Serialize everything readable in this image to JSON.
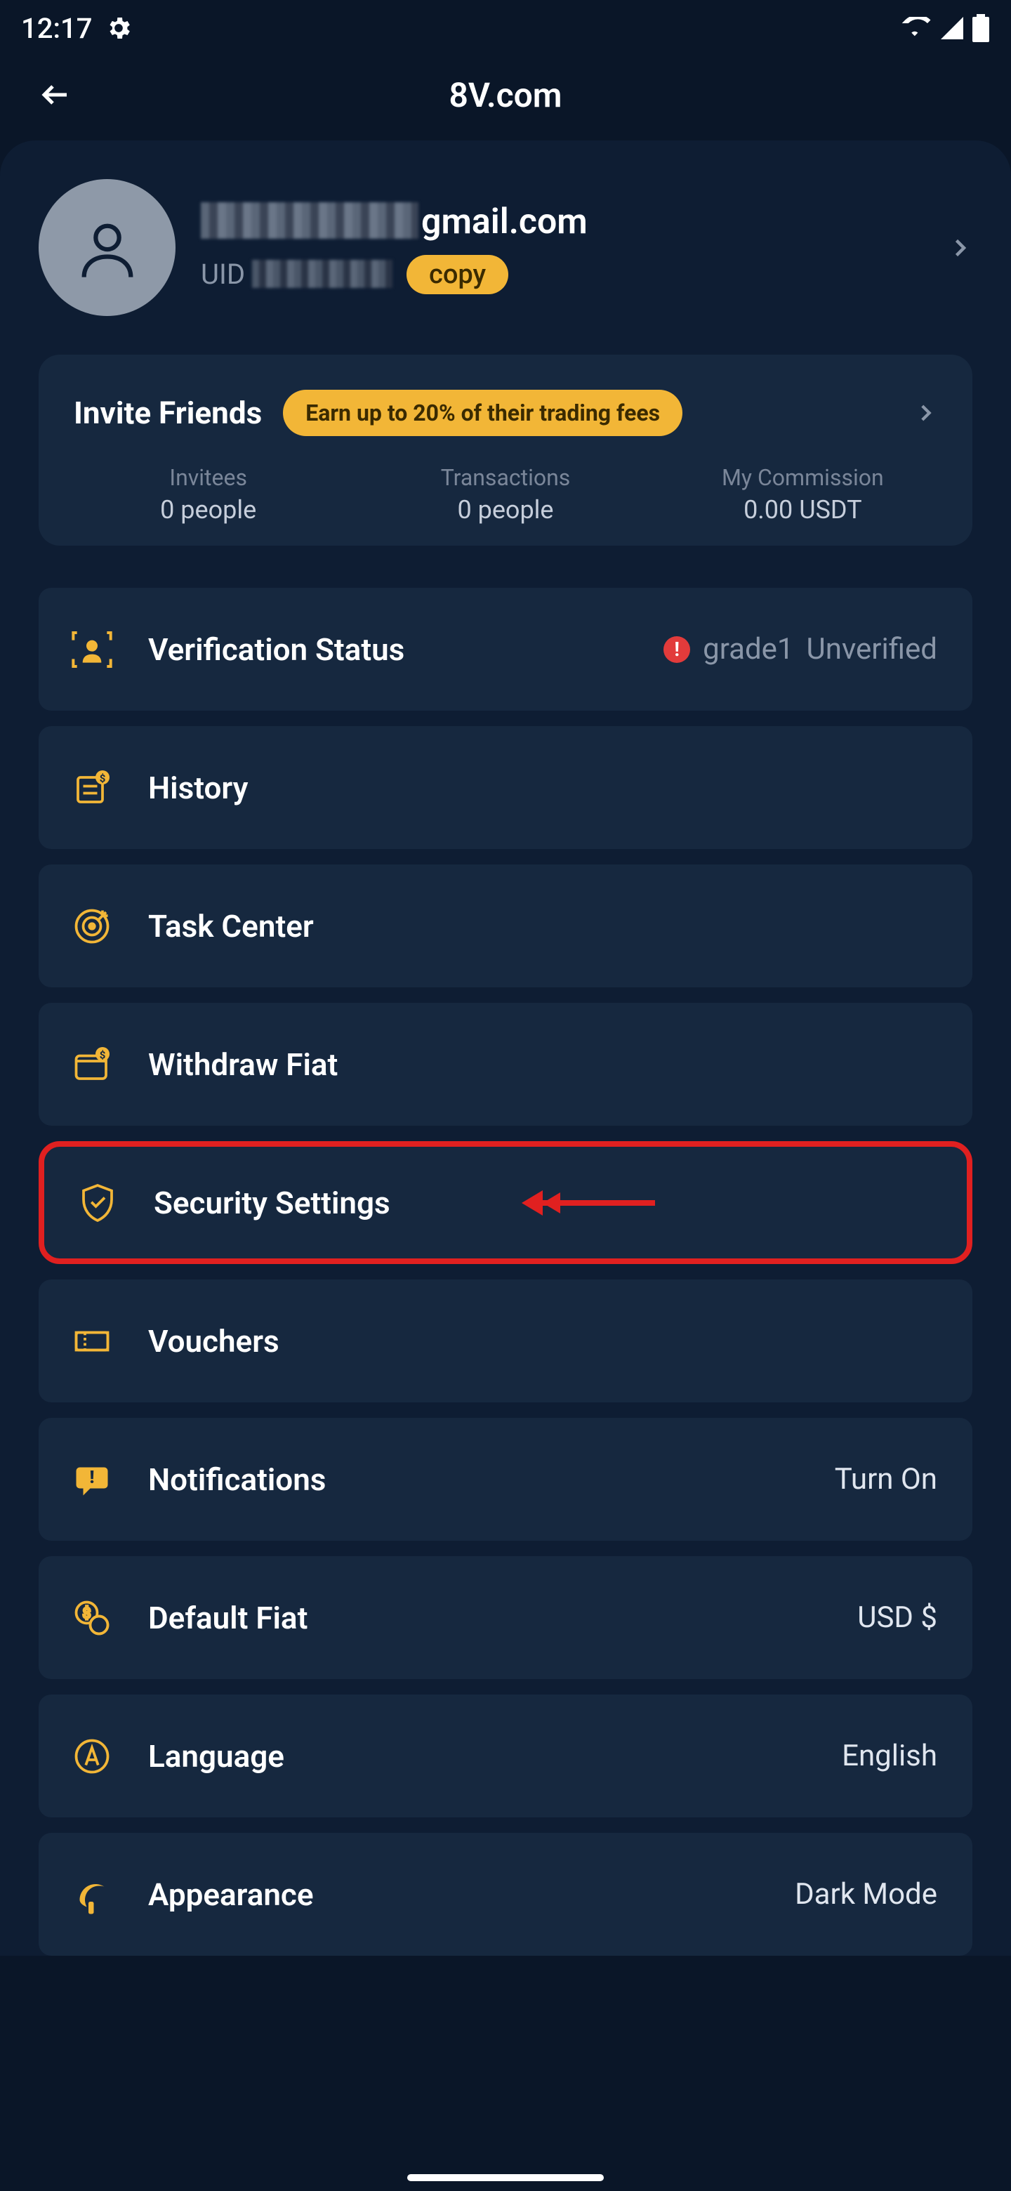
{
  "status_bar": {
    "time": "12:17",
    "gear_icon": true
  },
  "header": {
    "title": "8V.com"
  },
  "profile": {
    "email_suffix": "gmail.com",
    "uid_label": "UID",
    "copy_label": "copy"
  },
  "invite": {
    "title": "Invite Friends",
    "badge": "Earn up to 20% of their trading fees",
    "stats": [
      {
        "label": "Invitees",
        "value": "0 people"
      },
      {
        "label": "Transactions",
        "value": "0 people"
      },
      {
        "label": "My Commission",
        "value": "0.00 USDT"
      }
    ]
  },
  "verification": {
    "label": "Verification Status",
    "grade": "grade1",
    "status": "Unverified"
  },
  "menu": {
    "history": "History",
    "task_center": "Task Center",
    "withdraw_fiat": "Withdraw Fiat",
    "security_settings": "Security Settings",
    "vouchers": "Vouchers",
    "notifications": {
      "label": "Notifications",
      "value": "Turn On"
    },
    "default_fiat": {
      "label": "Default Fiat",
      "value": "USD $"
    },
    "language": {
      "label": "Language",
      "value": "English"
    },
    "appearance": {
      "label": "Appearance",
      "value": "Dark Mode"
    }
  }
}
